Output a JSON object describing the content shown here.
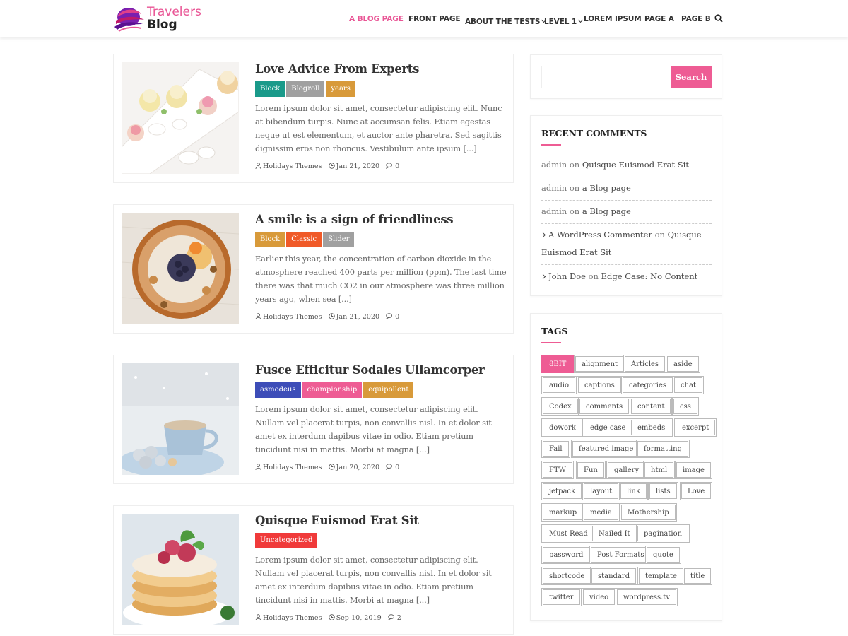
{
  "header": {
    "logo_line1": "Travelers",
    "logo_line2": "Blog",
    "nav": [
      {
        "label": "A BLOG PAGE",
        "active": true
      },
      {
        "label": "FRONT PAGE"
      },
      {
        "label": "ABOUT THE TESTS",
        "dropdown": true
      },
      {
        "label": "LEVEL 1",
        "dropdown": true
      },
      {
        "label": "LOREM IPSUM"
      },
      {
        "label": "PAGE A"
      },
      {
        "label": "PAGE B"
      }
    ],
    "search_icon": "search-icon"
  },
  "colors": {
    "accent": "#ee5c94",
    "teal": "#1a9a8a",
    "grey": "#a0a0a0",
    "mustard": "#d89a3a",
    "orange_red": "#f05a28",
    "navy": "#3d4db8",
    "pink": "#ee5c94",
    "red": "#f03a3a"
  },
  "posts": [
    {
      "title": "Love Advice From Experts",
      "categories": [
        {
          "label": "Block",
          "color": "#1a9a8a"
        },
        {
          "label": "Blogroll",
          "color": "#a0a0a0"
        },
        {
          "label": "years",
          "color": "#d89a3a"
        }
      ],
      "excerpt": "Lorem ipsum dolor sit amet, consectetur adipiscing elit. Nunc at bibendum turpis. Nunc at accumsan felis. Etiam egestas neque ut est elementum, et auctor ante pharetra. Sed sagittis dignissim eros non rhoncus. Vestibulum ante ipsum [...]",
      "author": "Holidays Themes",
      "date": "Jan 21, 2020",
      "comments": "0"
    },
    {
      "title": "A smile is a sign of friendliness",
      "categories": [
        {
          "label": "Block",
          "color": "#d89a3a"
        },
        {
          "label": "Classic",
          "color": "#f05a28"
        },
        {
          "label": "Slider",
          "color": "#a0a0a0"
        }
      ],
      "excerpt": "Earlier this year, the concentration of carbon dioxide in the atmosphere reached 400 parts per million (ppm). The last time there was that much CO2 in our atmosphere was three million years ago, when sea [...]",
      "author": "Holidays Themes",
      "date": "Jan 21, 2020",
      "comments": "0"
    },
    {
      "title": "Fusce Efficitur Sodales Ullamcorper",
      "categories": [
        {
          "label": "asmodeus",
          "color": "#3d4db8"
        },
        {
          "label": "championship",
          "color": "#ee5c94"
        },
        {
          "label": "equipollent",
          "color": "#d89a3a"
        }
      ],
      "excerpt": "Lorem ipsum dolor sit amet, consectetur adipiscing elit. Nullam vel placerat turpis, non convallis nisl. In et dolor sit amet ex interdum dapibus vitae in odio. Etiam pretium tincidunt nisi in mattis. Morbi at magna [...]",
      "author": "Holidays Themes",
      "date": "Jan 20, 2020",
      "comments": "0"
    },
    {
      "title": "Quisque Euismod Erat Sit",
      "categories": [
        {
          "label": "Uncategorized",
          "color": "#f03a3a"
        }
      ],
      "excerpt": "Lorem ipsum dolor sit amet, consectetur adipiscing elit. Nullam vel placerat turpis, non convallis nisl. In et dolor sit amet ex interdum dapibus vitae in odio. Etiam pretium tincidunt nisi in mattis. Morbi at magna [...]",
      "author": "Holidays Themes",
      "date": "Sep 10, 2019",
      "comments": "2"
    }
  ],
  "sidebar": {
    "search": {
      "placeholder": "",
      "button": "Search"
    },
    "recent_comments": {
      "title": "RECENT COMMENTS",
      "items": [
        {
          "author": "admin",
          "on": "on",
          "post": "Quisque Euismod Erat Sit"
        },
        {
          "author": "admin",
          "on": "on",
          "post": "a Blog page"
        },
        {
          "author": "admin",
          "on": "on",
          "post": "a Blog page"
        },
        {
          "author": "A WordPress Commenter",
          "on": "on",
          "post": "Quisque Euismod Erat Sit"
        },
        {
          "author": "John Doe",
          "on": "on",
          "post": "Edge Case: No Content"
        }
      ]
    },
    "tags": {
      "title": "TAGS",
      "items": [
        "8BIT",
        "alignment",
        "Articles",
        "aside",
        "audio",
        "captions",
        "categories",
        "chat",
        "Codex",
        "comments",
        "content",
        "css",
        "dowork",
        "edge case",
        "embeds",
        "excerpt",
        "Fail",
        "featured image",
        "formatting",
        "FTW",
        "Fun",
        "gallery",
        "html",
        "image",
        "jetpack",
        "layout",
        "link",
        "lists",
        "Love",
        "markup",
        "media",
        "Mothership",
        "Must Read",
        "Nailed It",
        "pagination",
        "password",
        "Post Formats",
        "quote",
        "shortcode",
        "standard",
        "template",
        "title",
        "twitter",
        "video",
        "wordpress.tv"
      ]
    }
  }
}
